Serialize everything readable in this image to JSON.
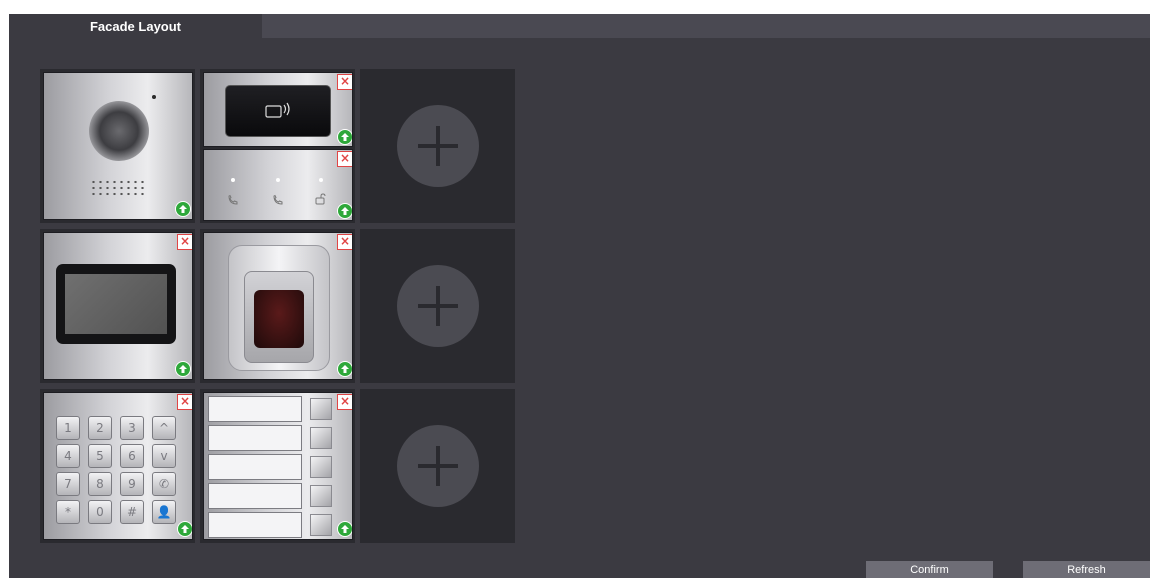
{
  "window": {
    "tab_label": "Facade Layout"
  },
  "layout": {
    "columns": 3,
    "rows": 3,
    "modules": [
      {
        "name": "camera-module",
        "has_delete": false,
        "has_upload": true
      },
      {
        "name": "card-reader-module",
        "has_delete": true,
        "has_upload": true
      },
      {
        "name": "indicator-module",
        "has_delete": true,
        "has_upload": true
      },
      {
        "name": "display-module",
        "has_delete": true,
        "has_upload": true
      },
      {
        "name": "fingerprint-module",
        "has_delete": true,
        "has_upload": true
      },
      {
        "name": "keypad-module",
        "has_delete": true,
        "has_upload": true
      },
      {
        "name": "button-module",
        "has_delete": true,
        "has_upload": true
      }
    ],
    "empty_slots": 3
  },
  "keypad": {
    "keys": [
      "1",
      "2",
      "3",
      "^",
      "4",
      "5",
      "6",
      "v",
      "7",
      "8",
      "9",
      "✆",
      "*",
      "0",
      "#",
      "👤"
    ]
  },
  "name_buttons": {
    "count": 5
  },
  "icons": {
    "delete": "×",
    "upload": "upload-arrow-icon",
    "add": "plus-icon"
  },
  "actions": {
    "confirm_label": "Confirm",
    "refresh_label": "Refresh"
  },
  "colors": {
    "background": "#3b3a41",
    "tab_bar": "#4a4952",
    "slot": "#2a2a2f",
    "delete": "#e04545",
    "upload": "#2ea83a",
    "button": "#6e6d76"
  }
}
